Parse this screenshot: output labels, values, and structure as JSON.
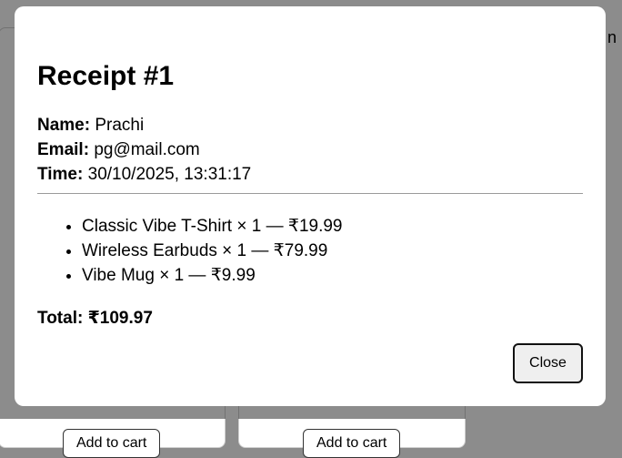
{
  "background": {
    "corner_text": "n",
    "add_to_cart_label": "Add to cart"
  },
  "receipt": {
    "title": "Receipt #1",
    "name_label": "Name:",
    "name_value": "Prachi",
    "email_label": "Email:",
    "email_value": "pg@mail.com",
    "time_label": "Time:",
    "time_value": "30/10/2025, 13:31:17",
    "items": [
      "Classic Vibe T-Shirt × 1 — ₹19.99",
      "Wireless Earbuds × 1 — ₹79.99",
      "Vibe Mug × 1 — ₹9.99"
    ],
    "total": "Total: ₹109.97",
    "close_label": "Close"
  }
}
